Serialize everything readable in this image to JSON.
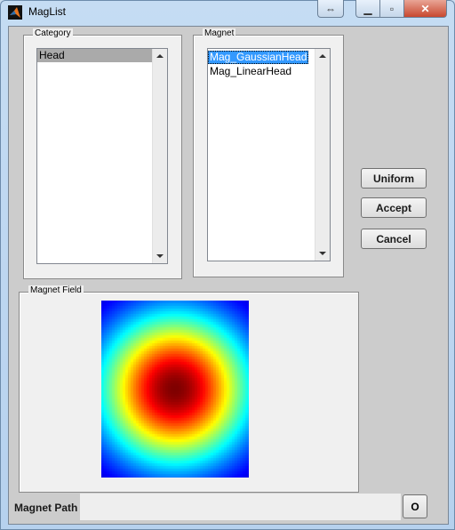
{
  "window": {
    "title": "MagList",
    "controls": {
      "swap": "⇔",
      "minimize": "▁",
      "maximize": "▫",
      "close": "✕"
    }
  },
  "category": {
    "label": "Category",
    "items": [
      "Head"
    ],
    "selected": "Head"
  },
  "magnet": {
    "label": "Magnet",
    "items": [
      "Mag_GaussianHead",
      "Mag_LinearHead"
    ],
    "selected": "Mag_GaussianHead"
  },
  "buttons": {
    "uniform": "Uniform",
    "accept": "Accept",
    "cancel": "Cancel",
    "open": "O"
  },
  "field": {
    "label": "Magnet Field",
    "colormap": "jet",
    "description": "Gaussian radial field, peak at center"
  },
  "path": {
    "label": "Magnet Path",
    "value": ""
  }
}
